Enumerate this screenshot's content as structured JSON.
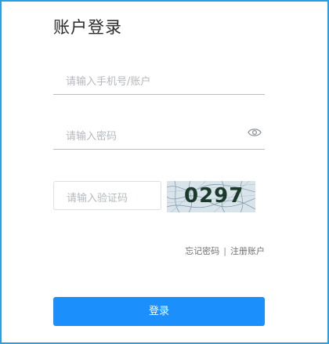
{
  "page": {
    "title": "账户登录"
  },
  "form": {
    "phone_placeholder": "请输入手机号/账户",
    "password_placeholder": "请输入密码",
    "captcha_placeholder": "请输入验证码",
    "captcha_code": "0297"
  },
  "links": {
    "forgot_password": "忘记密码",
    "separator": "|",
    "register": "注册账户"
  },
  "buttons": {
    "login_label": "登录"
  },
  "colors": {
    "accent": "#1b8ffb",
    "frame_border": "#28a0e6"
  },
  "icons": {
    "password_toggle": "eye-icon"
  }
}
